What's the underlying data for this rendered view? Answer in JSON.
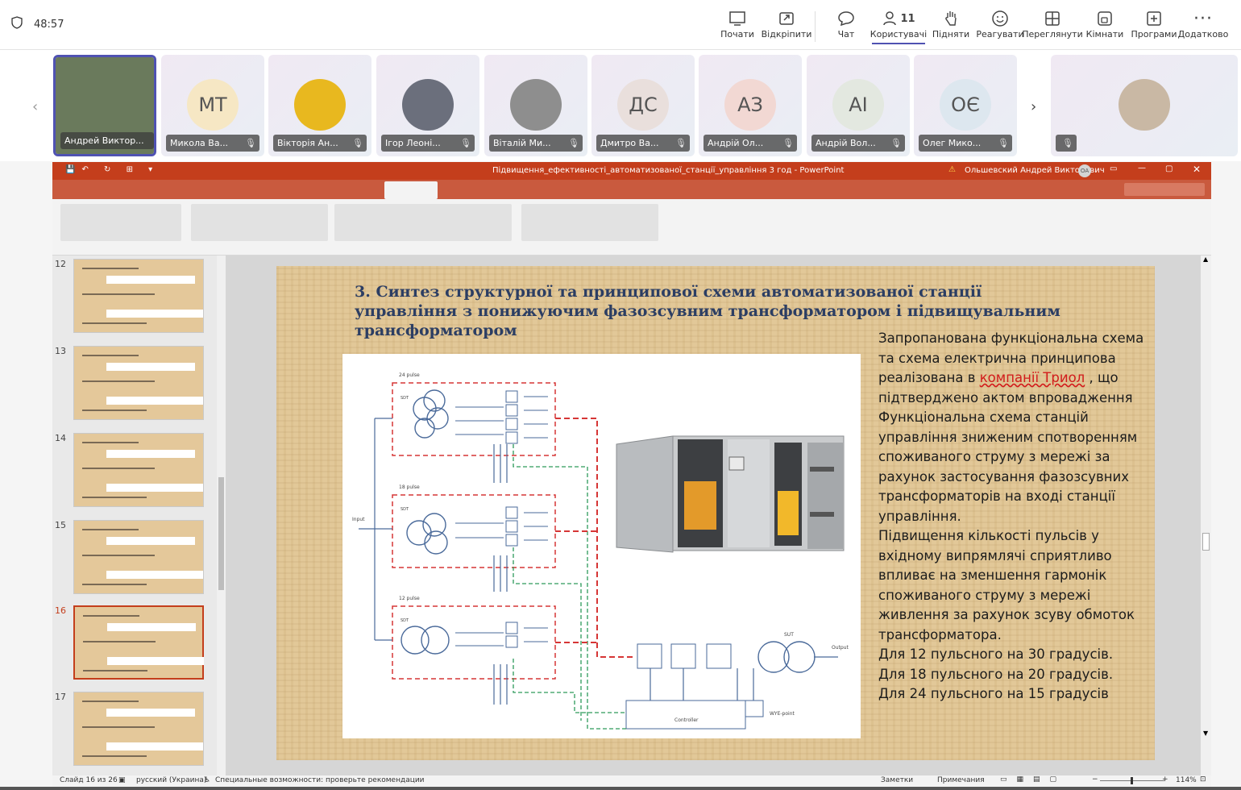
{
  "teams": {
    "timer": "48:57",
    "actions": [
      {
        "icon": "camera-icon",
        "label": "Почати"
      },
      {
        "icon": "share-icon",
        "label": "Відкріпити"
      },
      {
        "icon": "chat-icon",
        "label": "Чат"
      },
      {
        "icon": "people-icon",
        "label": "Користувачі",
        "count": "11"
      },
      {
        "icon": "raise-hand-icon",
        "label": "Підняти"
      },
      {
        "icon": "react-icon",
        "label": "Реагувати"
      },
      {
        "icon": "view-icon",
        "label": "Переглянути"
      },
      {
        "icon": "rooms-icon",
        "label": "Кімнати"
      },
      {
        "icon": "apps-icon",
        "label": "Програми"
      },
      {
        "icon": "more-icon",
        "label": "Додатково"
      }
    ]
  },
  "participants": [
    {
      "name": "Андрей Виктор...",
      "initials": "",
      "photo": true,
      "color": "#6a7a5c"
    },
    {
      "name": "Микола Ва...",
      "initials": "МТ",
      "color": "#f6e7c4"
    },
    {
      "name": "Вікторія Ан...",
      "initials": "",
      "photo": true,
      "color": "#e8b81f"
    },
    {
      "name": "Ігор Леоні...",
      "initials": "",
      "photo": true,
      "color": "#6b6f7c"
    },
    {
      "name": "Віталій Ми...",
      "initials": "",
      "photo": true,
      "color": "#8e8e8e"
    },
    {
      "name": "Дмитро Ва...",
      "initials": "ДС",
      "color": "#e9dfdc"
    },
    {
      "name": "Андрій Ол...",
      "initials": "АЗ",
      "color": "#f2d8d3"
    },
    {
      "name": "Андрій Вол...",
      "initials": "АІ",
      "color": "#e3e8e0"
    },
    {
      "name": "Олег Мико...",
      "initials": "ОЄ",
      "color": "#dde7ef"
    },
    {
      "name": "",
      "initials": "",
      "photo": true,
      "color": "#c9b8a4"
    }
  ],
  "ppt": {
    "title": "Підвищення_ефективності_автоматизованої_станції_управління 3 год  -  PowerPoint",
    "user": "Ольшевский Андрей Викторович",
    "user_initials": "ОА",
    "thumb_numbers": [
      "12",
      "13",
      "14",
      "15",
      "16",
      "17"
    ],
    "status_slide": "Слайд 16 из 26",
    "status_lang": "русский (Украина)",
    "status_access": "Специальные возможности: проверьте рекомендации",
    "status_notes": "Заметки",
    "status_comments": "Примечания",
    "zoom": "114%"
  },
  "slide": {
    "title": "3. Синтез структурної та принципової схеми автоматизованої станції управління з понижуючим фазозсувним трансформатором і підвищувальним трансформатором",
    "para1_a": "Запропанована функціональна схема та схема електрична принципова реалізована в ",
    "para1_red": "компанії Триол",
    "para1_b": " ,  що підтверджено актом впровадження",
    "para2": "Функціональна схема станцій управління  зниженим спотворенням споживаного струму з мережі за рахунок застосування фазозсувних трансформаторів на вході станції управління.",
    "para3": "Підвищення кількості пульсів у вхідному випрямлячі сприятливо впливає на зменшення гармонік споживаного струму  з мережі живлення  за рахунок зсуву обмоток трансформатора.",
    "line1": " Для 12 пульсного на 30 градусів.",
    "line2": "Для 18 пульсного на 20 градусів.",
    "line3": "Для 24 пульсного на 15 градусів",
    "diagram_labels": {
      "p24": "24 pulse",
      "p18": "18 pulse",
      "p12": "12 pulse",
      "sdt": "SDT",
      "input": "Input",
      "output": "Output",
      "sut": "SUT",
      "controller": "Controller",
      "wye": "WYE-point"
    }
  }
}
